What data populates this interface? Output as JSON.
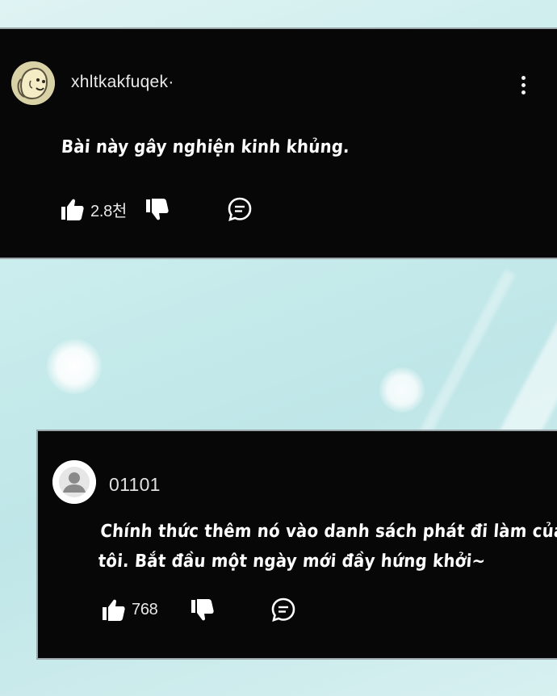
{
  "comments": [
    {
      "username": "xhltkakfuqek·",
      "text_lines": [
        "Bài này gây nghiện kinh khủng."
      ],
      "likes": "2.8천"
    },
    {
      "username": "01101",
      "text_lines": [
        "Chính thức thêm nó vào danh sách phát đi làm của",
        "tôi. Bắt đầu một ngày mới đầy hứng khởi~"
      ],
      "likes": "768"
    }
  ],
  "icons": {
    "like": "thumbs-up-icon",
    "dislike": "thumbs-down-icon",
    "reply": "comment-bubble-icon",
    "menu": "more-vertical-icon"
  },
  "colors": {
    "card": "#070707",
    "background": "#c9ecec",
    "text": "#ffffff"
  }
}
